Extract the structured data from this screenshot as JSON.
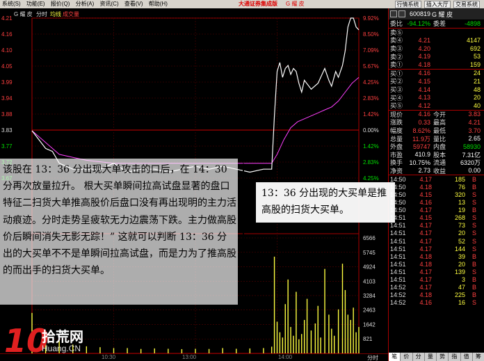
{
  "menu": {
    "items": [
      "系统(S)",
      "功能(E)",
      "报价(Q)",
      "分析(A)",
      "资讯(C)",
      "查看(V)",
      "帮助(H)"
    ],
    "app_title": "大通证券集成版",
    "window_title": "G 耀 皮",
    "sys_buttons": [
      "行情系统",
      "插入大厅",
      "交易系统"
    ]
  },
  "chart_header": {
    "name": "G 耀 皮",
    "mode": "分时",
    "avg_label": "均线",
    "vol_label": "成交量"
  },
  "price_axis": {
    "left": [
      "4.21",
      "4.16",
      "4.10",
      "4.05",
      "3.99",
      "3.94",
      "3.88",
      "3.83",
      "3.77",
      "3.72",
      "3.67"
    ],
    "right": [
      "9.92%",
      "8.50%",
      "7.09%",
      "5.67%",
      "4.25%",
      "2.83%",
      "1.42%",
      "0.00%",
      "1.42%",
      "2.83%",
      "4.25%"
    ]
  },
  "volume_axis": [
    "6566",
    "5745",
    "4924",
    "4103",
    "3284",
    "2463",
    "1642",
    "821"
  ],
  "time_axis": [
    "10:30",
    "13:00",
    "14:00",
    "分时"
  ],
  "chart_data": {
    "type": "line",
    "x_unit": "trading minutes (0 = 09:30, 240 = 15:00)",
    "ylim": [
      3.67,
      4.21
    ],
    "series": [
      {
        "name": "",
        "x": [
          0,
          5,
          10,
          15,
          20,
          30,
          40,
          50,
          60,
          70,
          80,
          90,
          100,
          110,
          120,
          130,
          140,
          150,
          160,
          170,
          176,
          178,
          180,
          182,
          184,
          186,
          188,
          190,
          192,
          194,
          196,
          198,
          200,
          205,
          210,
          215,
          218,
          220,
          223,
          225,
          228,
          230,
          232,
          234,
          236,
          238,
          240
        ],
        "y": [
          3.83,
          3.8,
          3.77,
          3.76,
          3.72,
          3.7,
          3.7,
          3.7,
          3.72,
          3.69,
          3.7,
          3.7,
          3.69,
          3.7,
          3.71,
          3.7,
          3.71,
          3.7,
          3.69,
          3.7,
          3.7,
          3.88,
          4.03,
          4.06,
          4.01,
          4.04,
          4.05,
          4.02,
          4.04,
          4.03,
          3.99,
          3.96,
          4.0,
          3.97,
          3.99,
          4.04,
          4.0,
          3.98,
          4.03,
          4.01,
          4.05,
          4.1,
          4.18,
          4.21,
          4.21,
          4.18,
          4.17
        ]
      },
      {
        "name": "均线",
        "x": [
          0,
          5,
          10,
          15,
          20,
          30,
          40,
          60,
          80,
          100,
          120,
          140,
          160,
          176,
          180,
          185,
          190,
          195,
          200,
          205,
          210,
          215,
          220,
          225,
          230,
          235,
          240
        ],
        "y": [
          3.83,
          3.81,
          3.79,
          3.77,
          3.75,
          3.74,
          3.73,
          3.72,
          3.72,
          3.72,
          3.72,
          3.72,
          3.72,
          3.72,
          3.75,
          3.8,
          3.84,
          3.86,
          3.87,
          3.88,
          3.89,
          3.9,
          3.91,
          3.93,
          3.96,
          3.99,
          4.01
        ]
      }
    ],
    "volume": {
      "x": [
        0,
        10,
        20,
        30,
        40,
        50,
        60,
        70,
        80,
        90,
        100,
        110,
        120,
        130,
        140,
        150,
        160,
        170,
        176,
        178,
        180,
        182,
        184,
        186,
        188,
        190,
        192,
        194,
        196,
        198,
        200,
        202,
        205,
        208,
        210,
        212,
        215,
        218,
        220,
        222,
        225,
        228,
        230,
        232,
        234,
        236,
        238,
        240
      ],
      "y": [
        2300,
        900,
        700,
        500,
        400,
        350,
        300,
        300,
        250,
        280,
        260,
        240,
        260,
        250,
        300,
        260,
        280,
        300,
        380,
        5500,
        1800,
        1200,
        900,
        2800,
        4200,
        1500,
        1000,
        3500,
        800,
        1100,
        1900,
        3100,
        1300,
        1700,
        2700,
        900,
        4800,
        2200,
        1400,
        1000,
        2500,
        5100,
        3600,
        2200,
        1900,
        2600,
        1200,
        1500
      ]
    }
  },
  "quote": {
    "code": "600819",
    "name": "G 耀 皮",
    "weibi_label": "委比",
    "weibi": "-94.12%",
    "weicha_label": "委差",
    "weicha": "-4898",
    "asks": [
      {
        "label": "卖⑤",
        "price": "",
        "vol": ""
      },
      {
        "label": "卖④",
        "price": "4.21",
        "vol": "4147"
      },
      {
        "label": "卖③",
        "price": "4.20",
        "vol": "692"
      },
      {
        "label": "卖②",
        "price": "4.19",
        "vol": "53"
      },
      {
        "label": "卖①",
        "price": "4.18",
        "vol": "159"
      }
    ],
    "bids": [
      {
        "label": "买①",
        "price": "4.16",
        "vol": "24"
      },
      {
        "label": "买②",
        "price": "4.15",
        "vol": "21"
      },
      {
        "label": "买③",
        "price": "4.14",
        "vol": "48"
      },
      {
        "label": "买④",
        "price": "4.13",
        "vol": "20"
      },
      {
        "label": "买⑤",
        "price": "4.12",
        "vol": "40"
      }
    ],
    "stats": [
      {
        "l1": "现价",
        "v1": "4.16",
        "l2": "今开",
        "v2": "3.83"
      },
      {
        "l1": "涨跌",
        "v1": "0.33",
        "l2": "最高",
        "v2": "4.21"
      },
      {
        "l1": "幅度",
        "v1": "8.62%",
        "l2": "最低",
        "v2": "3.70"
      },
      {
        "l1": "总量",
        "v1": "11.9万",
        "l2": "量比",
        "v2": "2.65"
      },
      {
        "l1": "外盘",
        "v1": "59747",
        "l2": "内盘",
        "v2": "58930"
      },
      {
        "l1": "市盈",
        "v1": "410.9",
        "l2": "股本",
        "v2": "7.31亿"
      },
      {
        "l1": "换手",
        "v1": "10.75%",
        "l2": "流通",
        "v2": "6320万"
      },
      {
        "l1": "净资",
        "v1": "2.73",
        "l2": "收益",
        "v2": "0.00"
      }
    ]
  },
  "ticks": [
    {
      "t": "14:50",
      "p": "4.17",
      "v": "185",
      "d": "B"
    },
    {
      "t": "14:50",
      "p": "4.18",
      "v": "76",
      "d": "B"
    },
    {
      "t": "14:50",
      "p": "4.15",
      "v": "320",
      "d": "S"
    },
    {
      "t": "14:50",
      "p": "4.16",
      "v": "13",
      "d": "S"
    },
    {
      "t": "14:50",
      "p": "4.17",
      "v": "19",
      "d": "B"
    },
    {
      "t": "14:51",
      "p": "4.15",
      "v": "268",
      "d": "S"
    },
    {
      "t": "14:51",
      "p": "4.17",
      "v": "73",
      "d": "S"
    },
    {
      "t": "14:51",
      "p": "4.17",
      "v": "20",
      "d": "S"
    },
    {
      "t": "14:51",
      "p": "4.17",
      "v": "52",
      "d": "S"
    },
    {
      "t": "14:51",
      "p": "4.17",
      "v": "144",
      "d": "S"
    },
    {
      "t": "14:51",
      "p": "4.18",
      "v": "39",
      "d": "B"
    },
    {
      "t": "14:51",
      "p": "4.18",
      "v": "20",
      "d": "B"
    },
    {
      "t": "14:51",
      "p": "4.17",
      "v": "139",
      "d": "S"
    },
    {
      "t": "14:51",
      "p": "4.17",
      "v": "3",
      "d": "B"
    },
    {
      "t": "14:52",
      "p": "4.17",
      "v": "47",
      "d": "B"
    },
    {
      "t": "14:52",
      "p": "4.18",
      "v": "225",
      "d": "B"
    },
    {
      "t": "14:52",
      "p": "4.16",
      "v": "16",
      "d": "S"
    }
  ],
  "side_tabs": [
    "笔",
    "价",
    "分",
    "量",
    "势",
    "指",
    "值",
    "筹"
  ],
  "annotation_text": "该股在 13：36 分出现大单攻击的口后，在 14：30 分再次放量拉升。 根大买单瞬间拉高试盘显著的盘口特征二扫货大单推高股价后盘口没有再出现明的主力活动痕迹。分时走势呈疲软无力边震荡下跌。主力做高股价后瞬间消失无影无踪！” 这就可以判断 13：36 分出的大买单不不是单瞬间拉高试盘，而是力为了推高股的而出手的扫货大买单。",
  "callout_text": "13：36 分出现的大买单是推高股的扫货大买单。",
  "logo": {
    "number": "10",
    "name": "拾荒网",
    "url": "Huang.CN"
  }
}
